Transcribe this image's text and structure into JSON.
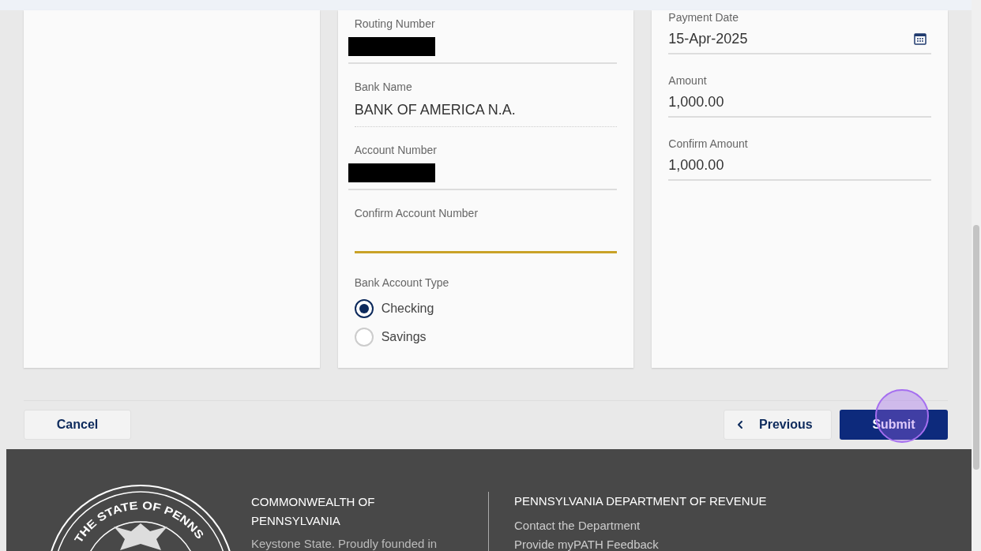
{
  "bank_fields": [
    {
      "label": "Routing Number",
      "kind": "redacted"
    },
    {
      "label": "Bank Name",
      "value": "BANK OF AMERICA N.A.",
      "kind": "readonly"
    },
    {
      "label": "Account Number",
      "kind": "redacted"
    },
    {
      "label": "Confirm Account Number",
      "kind": "input",
      "focused": true
    }
  ],
  "account_type": {
    "label": "Bank Account Type",
    "options": [
      {
        "label": "Checking",
        "selected": true
      },
      {
        "label": "Savings",
        "selected": false
      }
    ]
  },
  "payment_fields": [
    {
      "label": "Payment Date",
      "value": "15-Apr-2025",
      "kind": "date"
    },
    {
      "label": "Amount",
      "value": "1,000.00",
      "kind": "text"
    },
    {
      "label": "Confirm Amount",
      "value": "1,000.00",
      "kind": "text"
    }
  ],
  "actions": {
    "cancel": "Cancel",
    "previous": "Previous",
    "submit": "Submit"
  },
  "footer": {
    "seal_text": "THE STATE OF PENNS",
    "org_title": "COMMONWEALTH OF PENNSYLVANIA",
    "org_text": "Keystone State. Proudly founded in",
    "dept_title": "PENNSYLVANIA DEPARTMENT OF REVENUE",
    "links": [
      "Contact the Department",
      "Provide myPATH Feedback"
    ]
  }
}
